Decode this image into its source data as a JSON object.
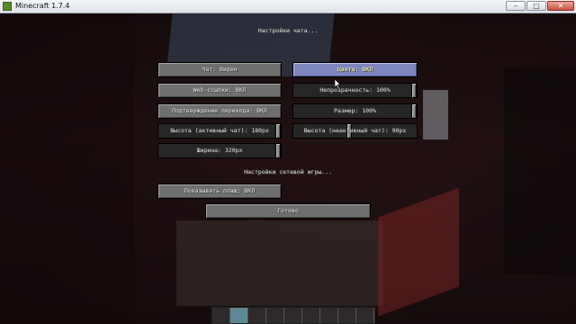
{
  "window": {
    "title": "Minecraft 1.7.4",
    "min_label": "–",
    "max_label": "□",
    "close_label": "✕"
  },
  "chat_settings": {
    "heading": "Настройки чата...",
    "chat": "Чат: Виден",
    "colors": "Цвета: ВКЛ",
    "web_links": "Web-ссылки: ВКЛ",
    "opacity": {
      "label": "Непрозрачность: 100%",
      "value": 1.0
    },
    "link_confirm": "Подтверждение перехода: ВКЛ",
    "size": {
      "label": "Размер: 100%",
      "value": 1.0
    },
    "height_focused": {
      "label": "Высота (активный чат): 180px",
      "value": 1.0
    },
    "height_unfocused": {
      "label": "Высота (неактивный чат): 90px",
      "value": 0.45
    },
    "width": {
      "label": "Ширина: 320px",
      "value": 1.0
    }
  },
  "multiplayer_settings": {
    "heading": "Настройки сетевой игры...",
    "show_cape": "Показывать плащ: ВКЛ"
  },
  "done": "Готово"
}
